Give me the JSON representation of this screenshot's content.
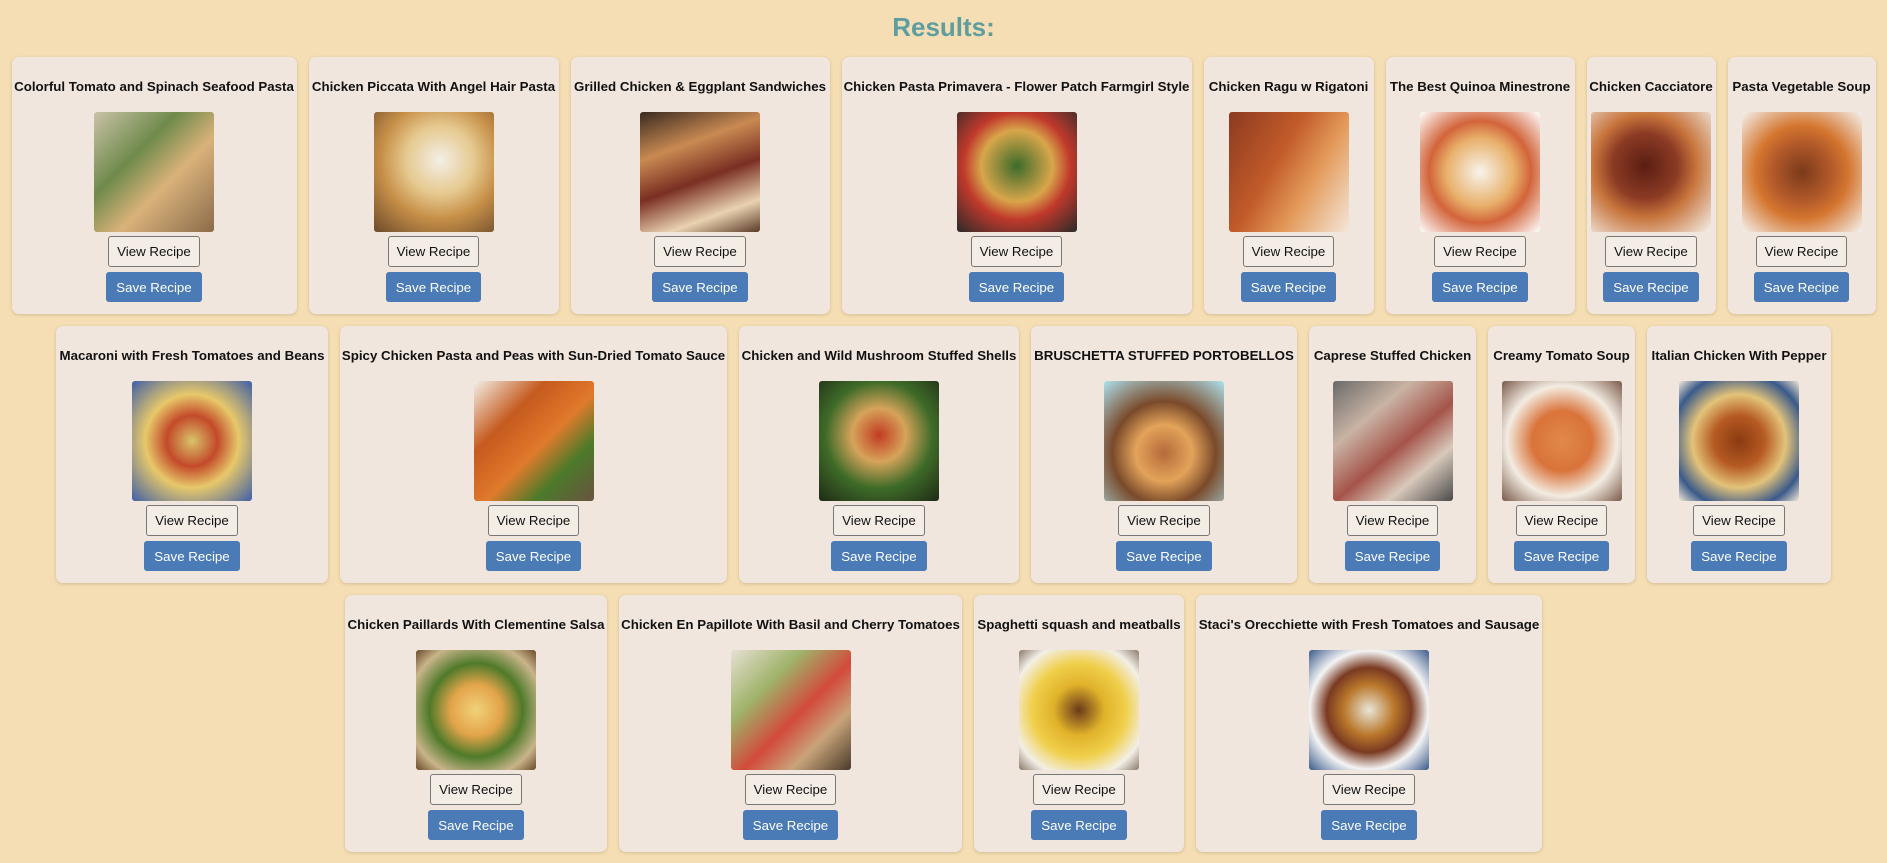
{
  "header": {
    "title": "Results:"
  },
  "buttons": {
    "view_label": "View Recipe",
    "save_label": "Save Recipe"
  },
  "colors": {
    "background": "#f5deb3",
    "title": "#5f9ea0",
    "card": "#f1e6dd",
    "save_button": "#4a7bb7"
  },
  "recipes": [
    {
      "title": "Colorful Tomato and Spinach Seafood Pasta",
      "image_desc": "seafood pasta with spinach"
    },
    {
      "title": "Chicken Piccata With Angel Hair Pasta",
      "image_desc": "chicken piccata over angel hair"
    },
    {
      "title": "Grilled Chicken & Eggplant Sandwiches",
      "image_desc": "grilled sandwiches"
    },
    {
      "title": "Chicken Pasta Primavera - Flower Patch Farmgirl Style",
      "image_desc": "pasta primavera in skillet"
    },
    {
      "title": "Chicken Ragu w Rigatoni",
      "image_desc": "rigatoni with ragu"
    },
    {
      "title": "The Best Quinoa Minestrone",
      "image_desc": "quinoa minestrone in cup"
    },
    {
      "title": "Chicken Cacciatore",
      "image_desc": "chicken cacciatore on plate"
    },
    {
      "title": "Pasta Vegetable Soup",
      "image_desc": "vegetable soup in bowl"
    },
    {
      "title": "Macaroni with Fresh Tomatoes and Beans",
      "image_desc": "macaroni salad with beans"
    },
    {
      "title": "Spicy Chicken Pasta and Peas with Sun-Dried Tomato Sauce",
      "image_desc": "penne with basil"
    },
    {
      "title": "Chicken and Wild Mushroom Stuffed Shells",
      "image_desc": "stuffed shells with salad"
    },
    {
      "title": "BRUSCHETTA STUFFED PORTOBELLOS",
      "image_desc": "stuffed portobello mushroom"
    },
    {
      "title": "Caprese Stuffed Chicken",
      "image_desc": "caprese chicken in pan"
    },
    {
      "title": "Creamy Tomato Soup",
      "image_desc": "tomato soup in bowl"
    },
    {
      "title": "Italian Chicken With Pepper",
      "image_desc": "chicken on decorative plate"
    },
    {
      "title": "Chicken Paillards With Clementine Salsa",
      "image_desc": "chicken with asparagus"
    },
    {
      "title": "Chicken En Papillote With Basil and Cherry Tomatoes",
      "image_desc": "chicken en papillote"
    },
    {
      "title": "Spaghetti squash and meatballs",
      "image_desc": "spaghetti squash with meatballs"
    },
    {
      "title": "Staci's Orecchiette with Fresh Tomatoes and Sausage",
      "image_desc": "orecchiette in bowl"
    }
  ]
}
